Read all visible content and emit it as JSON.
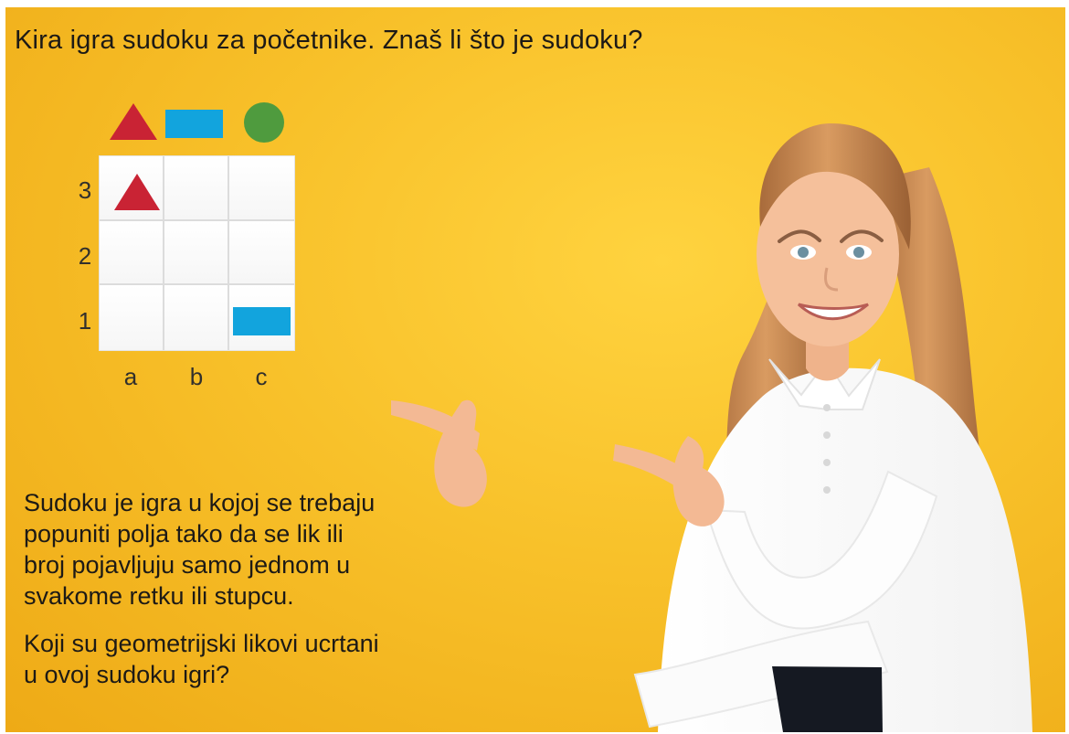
{
  "lesson": {
    "title": "Kira igra sudoku za početnike. Znaš li što je sudoku?",
    "description": "Sudoku je igra u kojoj se trebaju\npopuniti polja tako da se lik ili\nbroj pojavljuju samo jednom u\nsvakome retku ili stupcu.",
    "question": "Koji su geometrijski likovi ucrtani\nu ovoj sudoku igri?"
  },
  "legend": {
    "shapes": [
      "triangle",
      "rectangle",
      "circle"
    ]
  },
  "sudoku": {
    "rows": [
      "3",
      "2",
      "1"
    ],
    "columns": [
      "a",
      "b",
      "c"
    ],
    "placed": [
      {
        "shape": "triangle",
        "row": "3",
        "column": "a"
      },
      {
        "shape": "rectangle",
        "row": "1",
        "column": "c"
      }
    ]
  },
  "colors": {
    "background": "#f8c12a",
    "triangle": "#c92334",
    "rectangle": "#12a4dd",
    "circle": "#4f9b3e",
    "shirt": "#ffffff",
    "hair": "#c98b54"
  },
  "illustration": {
    "subject": "smiling girl pointing at the sudoku"
  }
}
